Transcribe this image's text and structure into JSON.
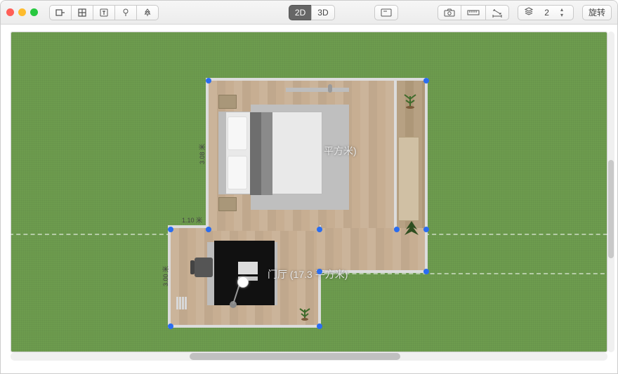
{
  "traffic": {
    "close": "",
    "min": "",
    "max": ""
  },
  "toolbar": {
    "left_tools": {
      "create_room": "create-room",
      "grid": "grid",
      "text": "text",
      "tree1": "tree-deciduous",
      "tree2": "tree-conifer"
    },
    "view": {
      "d2": "2D",
      "d3": "3D"
    },
    "screenshot": "screenshot",
    "annotate": "annotate",
    "camera": "camera",
    "measure": "measure",
    "dimension": "dimension",
    "layers_icon": "layers",
    "layers_value": "2",
    "rotate_label": "旋转"
  },
  "rooms": {
    "bedroom": {
      "label": "平方米)"
    },
    "hallway": {
      "label": "门厅 (17.3 平方米)"
    }
  },
  "dimensions": {
    "bedroom_h": "3.08 米",
    "hallway_w": "1.10 米",
    "hallway_h": "3.00 米"
  },
  "icons": {
    "layers": "≋"
  }
}
